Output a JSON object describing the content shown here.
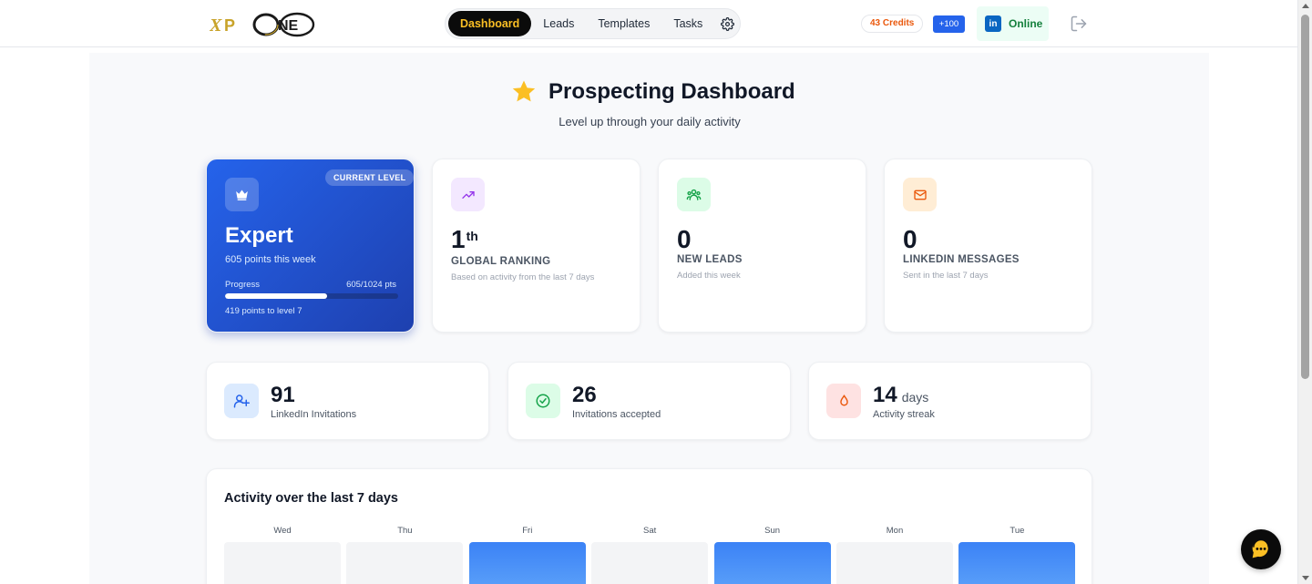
{
  "header": {
    "logo_text": "XPONE",
    "nav": [
      {
        "label": "Dashboard",
        "active": true
      },
      {
        "label": "Leads",
        "active": false
      },
      {
        "label": "Templates",
        "active": false
      },
      {
        "label": "Tasks",
        "active": false
      }
    ],
    "settings_icon": "gear-icon",
    "credits": "43 Credits",
    "add_credits": "+100",
    "linkedin_logo": "in",
    "linkedin_status": "Online",
    "logout_icon": "logout-icon"
  },
  "page": {
    "title": "Prospecting Dashboard",
    "title_icon": "star-icon",
    "subtitle": "Level up through your daily activity"
  },
  "level": {
    "badge": "CURRENT LEVEL",
    "name": "Expert",
    "points_week": "605 points this week",
    "progress_label": "Progress",
    "progress_value": "605/1024 pts",
    "progress_fraction": 0.59,
    "remaining": "419 points to level 7",
    "icon": "crown-icon"
  },
  "stats": [
    {
      "icon": "trending-up-icon",
      "value": "1",
      "suffix": "th",
      "label": "GLOBAL RANKING",
      "sub": "Based on activity from the last 7 days"
    },
    {
      "icon": "users-icon",
      "value": "0",
      "suffix": "",
      "label": "NEW LEADS",
      "sub": "Added this week"
    },
    {
      "icon": "mail-icon",
      "value": "0",
      "suffix": "",
      "label": "LINKEDIN MESSAGES",
      "sub": "Sent in the last 7 days"
    }
  ],
  "mini_stats": [
    {
      "icon": "user-plus-icon",
      "value": "91",
      "unit": "",
      "label": "LinkedIn Invitations"
    },
    {
      "icon": "check-circle-icon",
      "value": "26",
      "unit": "",
      "label": "Invitations accepted"
    },
    {
      "icon": "flame-icon",
      "value": "14",
      "unit": "days",
      "label": "Activity streak"
    }
  ],
  "activity": {
    "title": "Activity over the last 7 days",
    "days": [
      {
        "label": "Wed",
        "active": false
      },
      {
        "label": "Thu",
        "active": false
      },
      {
        "label": "Fri",
        "active": true
      },
      {
        "label": "Sat",
        "active": false
      },
      {
        "label": "Sun",
        "active": true
      },
      {
        "label": "Mon",
        "active": false
      },
      {
        "label": "Tue",
        "active": true
      }
    ]
  },
  "colors": {
    "accent": "#2563eb",
    "brand_gold": "#fbbf24",
    "active_bar": "#3b82f6",
    "inactive_bar": "#f3f4f6"
  },
  "chat_icon": "support-chat-icon"
}
